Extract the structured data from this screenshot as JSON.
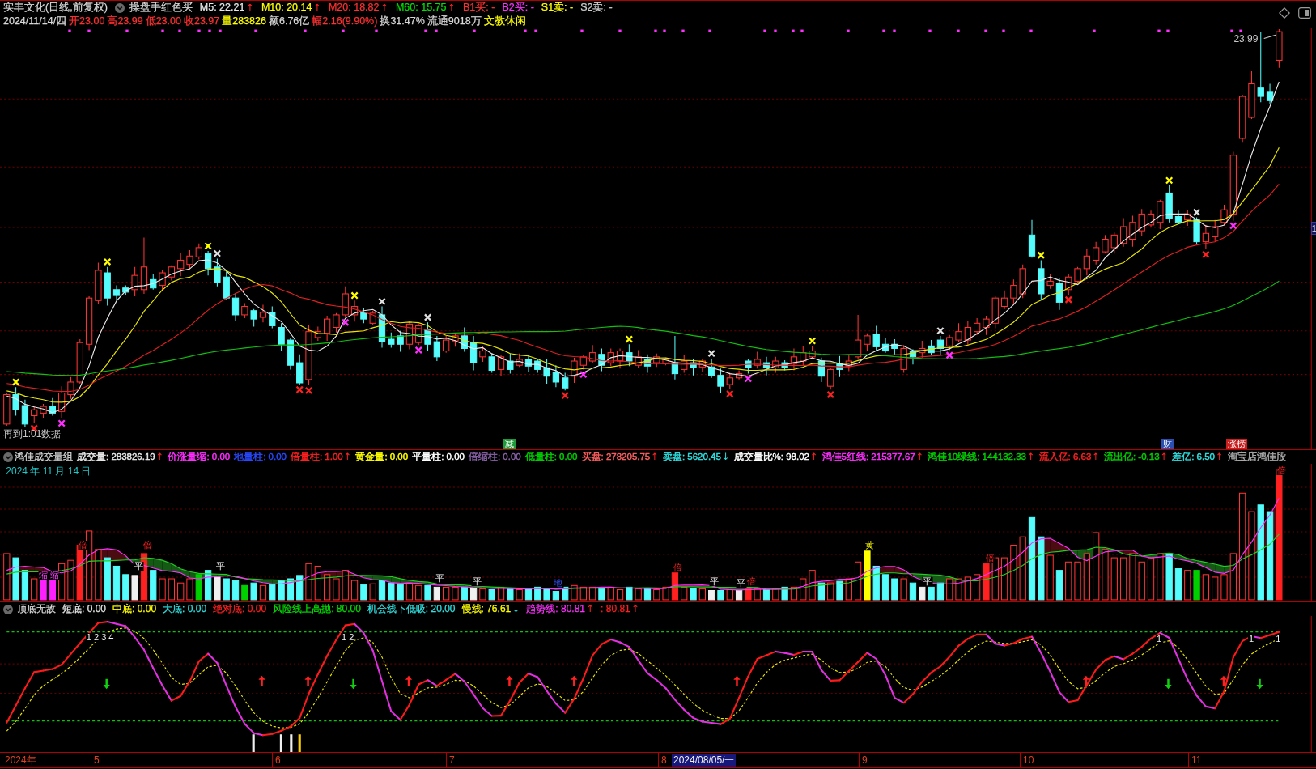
{
  "stock_header": {
    "title": "实丰文化(日线,前复权)",
    "indicator": "操盘手红色买",
    "readings": [
      {
        "text": "M5: 22.21",
        "arrow": "↑",
        "rising": true,
        "color": "#e8e8e8"
      },
      {
        "text": "M10: 20.14",
        "arrow": "↑",
        "rising": true,
        "color": "#ffff00"
      },
      {
        "text": "M20: 18.82",
        "arrow": "↑",
        "rising": true,
        "color": "#ff3030"
      },
      {
        "text": "M60: 15.75",
        "arrow": "↑",
        "rising": true,
        "color": "#00e000"
      },
      {
        "text": "B1买: -",
        "color": "#ff3030"
      },
      {
        "text": "B2买: -",
        "color": "#ff30ff"
      },
      {
        "text": "S1卖: -",
        "color": "#ffff00"
      },
      {
        "text": "S2卖: -",
        "color": "#d0d0d0"
      }
    ]
  },
  "quote": {
    "fields": [
      {
        "text": "2024/11/14/四",
        "color": "#d8d8d8"
      },
      {
        "text": "开23.00",
        "color": "#ff3030"
      },
      {
        "text": "高23.99",
        "color": "#ff3030"
      },
      {
        "text": "低23.00",
        "color": "#ff3030"
      },
      {
        "text": "收23.97",
        "color": "#ff3030"
      },
      {
        "text": "量283826",
        "color": "#ffff00"
      },
      {
        "text": "额6.76亿",
        "color": "#d8d8d8"
      },
      {
        "text": "幅2.16(9.90%)",
        "color": "#ff3030"
      },
      {
        "text": "换31.47%",
        "color": "#d8d8d8"
      },
      {
        "text": "流通9018万",
        "color": "#d8d8d8"
      },
      {
        "text": "文教休闲",
        "color": "#ffff00"
      }
    ]
  },
  "main_chart": {
    "high_label": "23.99",
    "note": "再到1:01数据",
    "axis_label": "1",
    "badges": [
      {
        "text": "减",
        "color": "#1f9a3a"
      },
      {
        "text": "财",
        "color": "#2a4fb0"
      },
      {
        "text": "涨榜",
        "color": "#c81e1e"
      }
    ]
  },
  "volume_panel": {
    "title": "鸿佳成交量组",
    "readings": [
      {
        "text": "成交量: 283826.19",
        "arrow": "↑",
        "rising": true,
        "color": "#e8e8e8"
      },
      {
        "text": "价涨量缩: 0.00",
        "color": "#ff30ff"
      },
      {
        "text": "地量柱: 0.00",
        "color": "#2848ff"
      },
      {
        "text": "倍量柱: 1.00",
        "arrow": "↑",
        "rising": true,
        "color": "#ff2020"
      },
      {
        "text": "黄金量: 0.00",
        "color": "#ffff00"
      },
      {
        "text": "平量柱: 0.00",
        "color": "#ffffff"
      },
      {
        "text": "倍缩柱: 0.00",
        "color": "#8a62a8"
      },
      {
        "text": "低量柱: 0.00",
        "color": "#00d000"
      },
      {
        "text": "买盘: 278205.75",
        "arrow": "↑",
        "rising": true,
        "color": "#ff6060"
      },
      {
        "text": "卖盘: 5620.45",
        "arrow": "↓",
        "rising": false,
        "color": "#30e0e0"
      },
      {
        "text": "成交量比%: 98.02",
        "arrow": "↑",
        "rising": true,
        "color": "#ffffff"
      },
      {
        "text": "鸿佳5红线: 215377.67",
        "arrow": "↑",
        "rising": true,
        "color": "#ff30ff"
      },
      {
        "text": "鸿佳10绿线: 144132.33",
        "arrow": "↑",
        "rising": true,
        "color": "#00d000"
      },
      {
        "text": "流入亿: 6.63",
        "arrow": "↑",
        "rising": true,
        "color": "#ff2020"
      },
      {
        "text": "流出亿: -0.13",
        "arrow": "↑",
        "rising": true,
        "color": "#00d000"
      },
      {
        "text": "差亿: 6.50",
        "arrow": "↑",
        "rising": true,
        "color": "#30e0e0"
      },
      {
        "text": "淘宝店鸿佳股",
        "color": "#a8a8a8"
      }
    ],
    "date": "2024 年 11 月 14 日",
    "marks": [
      {
        "text": "缩",
        "kind": "shrink"
      },
      {
        "text": "缩",
        "kind": "shrink"
      },
      {
        "text": "倍",
        "kind": "double"
      },
      {
        "text": "平",
        "kind": "flat"
      },
      {
        "text": "倍",
        "kind": "double"
      },
      {
        "text": "平",
        "kind": "flat"
      },
      {
        "text": "平",
        "kind": "flat"
      },
      {
        "text": "平",
        "kind": "flat"
      },
      {
        "text": "地",
        "kind": "ground"
      },
      {
        "text": "倍",
        "kind": "double"
      },
      {
        "text": "平",
        "kind": "flat"
      },
      {
        "text": "平",
        "kind": "flat"
      },
      {
        "text": "倍",
        "kind": "double"
      },
      {
        "text": "黄",
        "kind": "gold"
      },
      {
        "text": "平",
        "kind": "flat"
      },
      {
        "text": "倍",
        "kind": "double"
      },
      {
        "text": "倍",
        "kind": "double"
      }
    ]
  },
  "oscillator_panel": {
    "title": "顶底无敌",
    "readings": [
      {
        "text": "短底: 0.00",
        "color": "#e8e8e8"
      },
      {
        "text": "中底: 0.00",
        "color": "#ffff00"
      },
      {
        "text": "大底: 0.00",
        "color": "#30e0e0"
      },
      {
        "text": "绝对底: 0.00",
        "color": "#ff2020"
      },
      {
        "text": "风险线上高抛: 80.00",
        "color": "#00e000"
      },
      {
        "text": "机会线下低吸: 20.00",
        "color": "#30e0e0"
      },
      {
        "text": "慢线: 76.61",
        "arrow": "↓",
        "rising": false,
        "color": "#ffff00"
      },
      {
        "text": "趋势线: 80.81",
        "arrow": "↑",
        "rising": true,
        "color": "#ff30ff"
      },
      {
        "text": ": 80.81",
        "arrow": "↑",
        "rising": true,
        "color": "#ff2020"
      }
    ],
    "labels": [
      "1 2 3 4",
      "1 2",
      "1",
      "1",
      "1"
    ]
  },
  "x_axis": {
    "labels": [
      "2024年",
      "5",
      "6",
      "7",
      "8",
      "9",
      "10",
      "11"
    ],
    "cursor_date": "2024/08/05/一"
  }
}
